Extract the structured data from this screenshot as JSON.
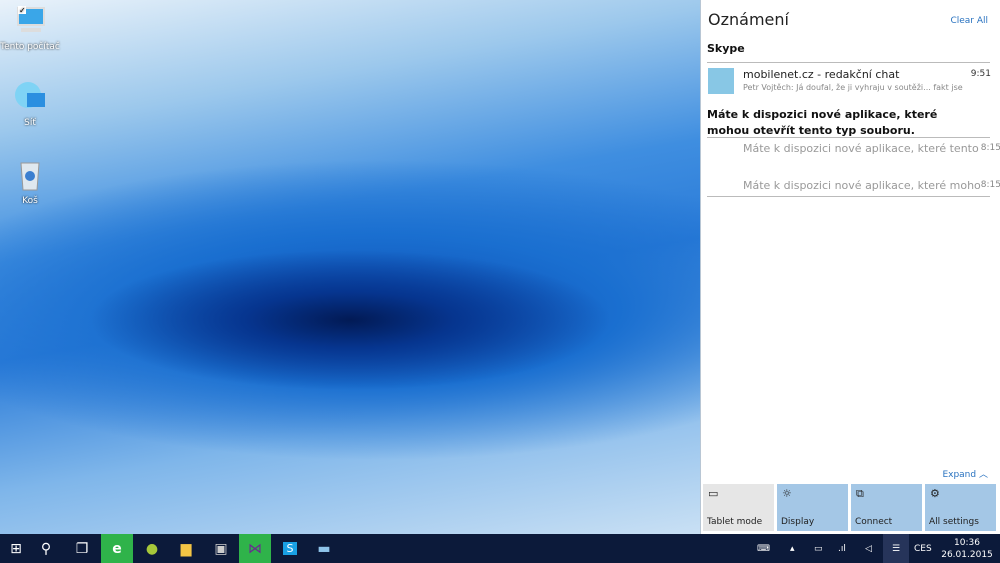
{
  "desktop": {
    "icons": [
      {
        "label": "Tento počítač",
        "icon": "computer-icon"
      },
      {
        "label": "Síť",
        "icon": "network-icon"
      },
      {
        "label": "Koš",
        "icon": "recycle-bin-icon"
      }
    ]
  },
  "action_center": {
    "title": "Oznámení",
    "clear_all": "Clear All",
    "groups": [
      {
        "app": "Skype",
        "notifications": [
          {
            "title": "mobilenet.cz - redakční chat",
            "body": "Petr Vojtěch: Já doufal, že ji vyhraju v soutěži... fakt jse",
            "time": "9:51"
          }
        ]
      }
    ],
    "app_group": {
      "title": "Máte k dispozici nové aplikace, které mohou otevřít tento typ souboru.",
      "items": [
        {
          "text": "Máte k dispozici nové aplikace, které tento",
          "time": "8:15"
        },
        {
          "text": "Máte k dispozici nové aplikace, které moho",
          "time": "8:15"
        }
      ]
    },
    "expand": "Expand",
    "quick_actions": [
      {
        "label": "Tablet mode",
        "icon": "tablet-icon",
        "active": false
      },
      {
        "label": "Display",
        "icon": "brightness-icon",
        "active": true
      },
      {
        "label": "Connect",
        "icon": "connect-icon",
        "active": true
      },
      {
        "label": "All settings",
        "icon": "gear-icon",
        "active": true
      }
    ],
    "accent": "#a4c7e6"
  },
  "taskbar": {
    "apps": [
      "start",
      "search",
      "task-view",
      "internet-explorer",
      "spotify",
      "file-explorer",
      "store",
      "visual-studio",
      "skype",
      "remote-desktop"
    ],
    "language": "CES",
    "time": "10:36",
    "date": "26.01.2015"
  }
}
